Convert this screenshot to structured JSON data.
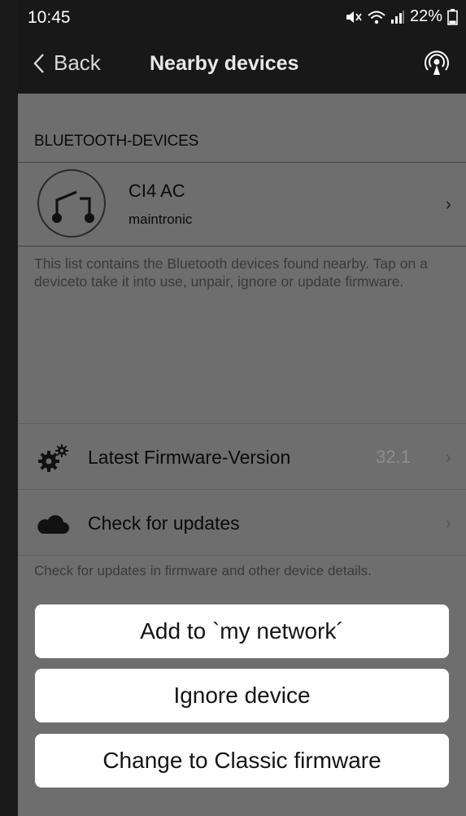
{
  "status_bar": {
    "time": "10:45",
    "battery": "22%"
  },
  "nav": {
    "back_label": "Back",
    "title": "Nearby devices"
  },
  "bluetooth_section": {
    "header": "BLUETOOTH-DEVICES",
    "device": {
      "name": "CI4 AC",
      "manufacturer": "maintronic"
    },
    "description": "This list contains the Bluetooth devices found nearby. Tap on a deviceto take it into use, unpair, ignore or update firmware."
  },
  "firmware_section": {
    "latest_label": "Latest Firmware-Version",
    "latest_value": "32.1",
    "check_label": "Check for updates",
    "description": "Check for updates in firmware and other device details."
  },
  "actions": {
    "add_label": "Add to `my network´",
    "ignore_label": "Ignore device",
    "classic_label": "Change to Classic firmware"
  },
  "icons": {
    "device": "relay-switch-icon",
    "firmware": "gears-icon",
    "updates": "cloud-icon",
    "nav_right": "radar-icon"
  },
  "colors": {
    "nav_bg": "#181818",
    "content_bg": "#6e6e6e",
    "button_bg": "#ffffff"
  }
}
